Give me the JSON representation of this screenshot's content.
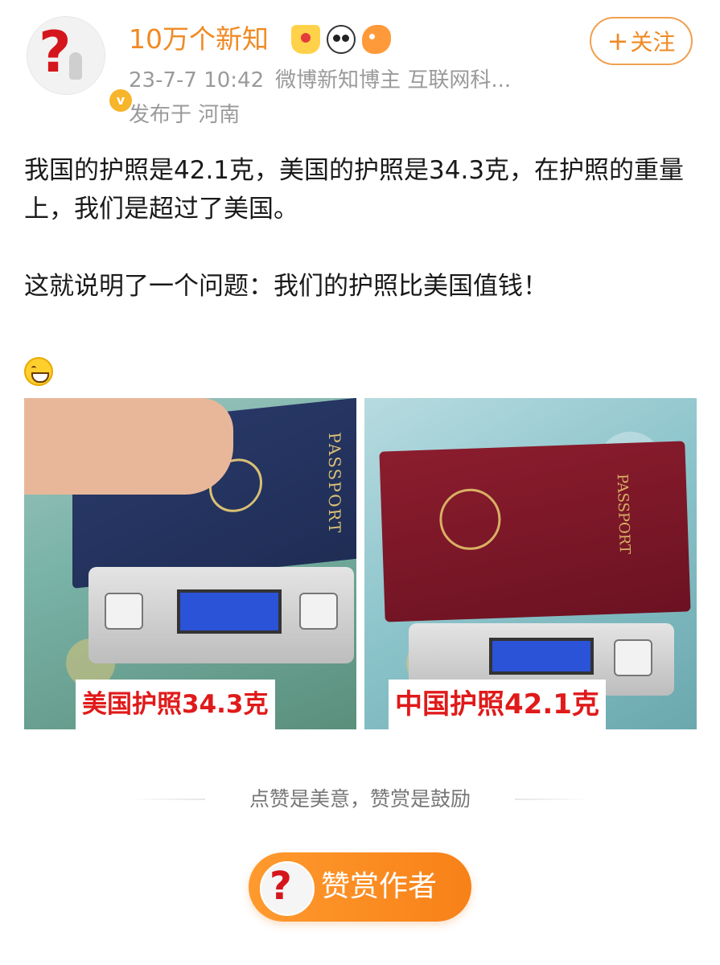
{
  "author": {
    "name": "10万个新知",
    "avatar_icon": "question-mark-figure-icon",
    "badges": [
      "crown-badge-icon",
      "panda-icon",
      "fish-icon"
    ],
    "verified_icon": "verified-v-icon"
  },
  "meta": {
    "time": "23-7-7 10:42",
    "tags": "微博新知博主 互联网科...",
    "location": "发布于 河南"
  },
  "follow": {
    "plus": "+",
    "label": "关注"
  },
  "post": {
    "paragraph1": "我国的护照是42.1克，美国的护照是34.3克，在护照的重量上，我们是超过了美国。",
    "paragraph2": "这就说明了一个问题：我们的护照比美国值钱！",
    "emoji": "grin-emoji-icon"
  },
  "images": [
    {
      "caption": "美国护照34.3克"
    },
    {
      "caption": "中国护照42.1克"
    }
  ],
  "reward": {
    "slogan": "点赞是美意，赞赏是鼓励",
    "button_label": "赞赏作者"
  },
  "colors": {
    "accent": "#f08a24",
    "caption_red": "#e01a1a",
    "reward_button": "#f78118"
  }
}
